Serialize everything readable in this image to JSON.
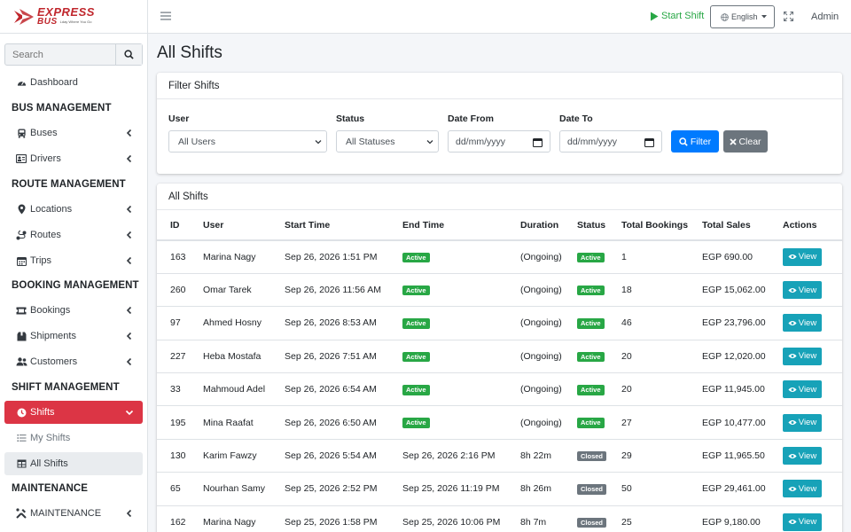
{
  "brand": {
    "line1": "EXPRESS",
    "line2": "BUS",
    "tagline": "Lday Where You Go"
  },
  "search": {
    "placeholder": "Search"
  },
  "nav": {
    "dashboard": "Dashboard",
    "h_bus": "BUS MANAGEMENT",
    "buses": "Buses",
    "drivers": "Drivers",
    "h_route": "ROUTE MANAGEMENT",
    "locations": "Locations",
    "routes": "Routes",
    "trips": "Trips",
    "h_booking": "BOOKING MANAGEMENT",
    "bookings": "Bookings",
    "shipments": "Shipments",
    "customers": "Customers",
    "h_shift": "SHIFT MANAGEMENT",
    "shifts": "Shifts",
    "my_shifts": "My Shifts",
    "all_shifts": "All Shifts",
    "h_maint": "MAINTENANCE",
    "maintenance": "MAINTENANCE"
  },
  "topbar": {
    "start_shift": "Start Shift",
    "language": "English",
    "user": "Admin"
  },
  "page": {
    "title": "All Shifts"
  },
  "filter": {
    "title": "Filter Shifts",
    "user_label": "User",
    "user_value": "All Users",
    "status_label": "Status",
    "status_value": "All Statuses",
    "date_from_label": "Date From",
    "date_from_placeholder": "dd/mm/yyyy",
    "date_to_label": "Date To",
    "date_to_placeholder": "dd/mm/yyyy",
    "filter_btn": "Filter",
    "clear_btn": "Clear"
  },
  "table": {
    "title": "All Shifts",
    "columns": [
      "ID",
      "User",
      "Start Time",
      "End Time",
      "Duration",
      "Status",
      "Total Bookings",
      "Total Sales",
      "Actions"
    ],
    "view_label": "View",
    "rows": [
      {
        "id": "163",
        "user": "Marina Nagy",
        "start": "Sep 26, 2026 1:51 PM",
        "end": "",
        "end_badge": "Active",
        "duration": "(Ongoing)",
        "status": "Active",
        "bookings": "1",
        "sales": "EGP 690.00"
      },
      {
        "id": "260",
        "user": "Omar Tarek",
        "start": "Sep 26, 2026 11:56 AM",
        "end": "",
        "end_badge": "Active",
        "duration": "(Ongoing)",
        "status": "Active",
        "bookings": "18",
        "sales": "EGP 15,062.00"
      },
      {
        "id": "97",
        "user": "Ahmed Hosny",
        "start": "Sep 26, 2026 8:53 AM",
        "end": "",
        "end_badge": "Active",
        "duration": "(Ongoing)",
        "status": "Active",
        "bookings": "46",
        "sales": "EGP 23,796.00"
      },
      {
        "id": "227",
        "user": "Heba Mostafa",
        "start": "Sep 26, 2026 7:51 AM",
        "end": "",
        "end_badge": "Active",
        "duration": "(Ongoing)",
        "status": "Active",
        "bookings": "20",
        "sales": "EGP 12,020.00"
      },
      {
        "id": "33",
        "user": "Mahmoud Adel",
        "start": "Sep 26, 2026 6:54 AM",
        "end": "",
        "end_badge": "Active",
        "duration": "(Ongoing)",
        "status": "Active",
        "bookings": "20",
        "sales": "EGP 11,945.00"
      },
      {
        "id": "195",
        "user": "Mina Raafat",
        "start": "Sep 26, 2026 6:50 AM",
        "end": "",
        "end_badge": "Active",
        "duration": "(Ongoing)",
        "status": "Active",
        "bookings": "27",
        "sales": "EGP 10,477.00"
      },
      {
        "id": "130",
        "user": "Karim Fawzy",
        "start": "Sep 26, 2026 5:54 AM",
        "end": "Sep 26, 2026 2:16 PM",
        "end_badge": "",
        "duration": "8h 22m",
        "status": "Closed",
        "bookings": "29",
        "sales": "EGP 11,965.50"
      },
      {
        "id": "65",
        "user": "Nourhan Samy",
        "start": "Sep 25, 2026 2:52 PM",
        "end": "Sep 25, 2026 11:19 PM",
        "end_badge": "",
        "duration": "8h 26m",
        "status": "Closed",
        "bookings": "50",
        "sales": "EGP 29,461.00"
      },
      {
        "id": "162",
        "user": "Marina Nagy",
        "start": "Sep 25, 2026 1:58 PM",
        "end": "Sep 25, 2026 10:06 PM",
        "end_badge": "",
        "duration": "8h 7m",
        "status": "Closed",
        "bookings": "25",
        "sales": "EGP 9,180.00"
      }
    ]
  },
  "colors": {
    "primary": "#007bff",
    "danger": "#dc3545",
    "success": "#28a745",
    "info": "#17a2b8",
    "secondary": "#6c757d"
  }
}
